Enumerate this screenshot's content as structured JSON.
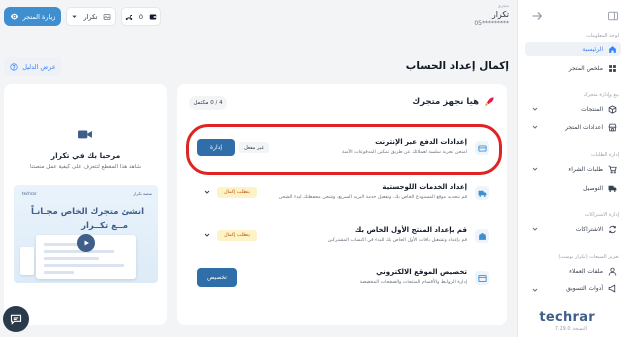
{
  "header": {
    "store_label": "متجري",
    "store_name": "تكرار",
    "phone": "05*********",
    "visit_store_label": "زيارة المتجر",
    "store_select_value": "تكرار",
    "stats_count": "0"
  },
  "sidebar": {
    "sections": [
      {
        "label": "لوحة المعلومات"
      },
      {
        "label": "بيع وإدارة متجرك"
      },
      {
        "label": "إدارة الطلبات"
      },
      {
        "label": "إدارة الاشتراكات"
      },
      {
        "label": "تعزيز المبيعات (تكرار بوست)"
      }
    ],
    "items": [
      {
        "label": "الرئيسية",
        "icon": "home-icon"
      },
      {
        "label": "ملخص المتجر",
        "icon": "grid-icon"
      },
      {
        "label": "المنتجات",
        "icon": "cube-icon"
      },
      {
        "label": "اعدادات المتجر",
        "icon": "store-icon"
      },
      {
        "label": "طلبات الشراء",
        "icon": "cart-icon"
      },
      {
        "label": "التوصيل",
        "icon": "truck-icon"
      },
      {
        "label": "الاشتراكات",
        "icon": "refresh-icon"
      },
      {
        "label": "ملفات العملاء",
        "icon": "user-icon"
      },
      {
        "label": "أدوات التسويق",
        "icon": "megaphone-icon"
      }
    ],
    "logo": "techrar",
    "version": "النسخة 7.29.0"
  },
  "page": {
    "title": "إكمال إعداد الحساب",
    "guide_label": "عرض الدليل"
  },
  "welcome": {
    "title": "مرحبا بك في تكرار",
    "subtitle": "شاهد هذا المقطع لتتعرف على كيفية عمل منصتنا",
    "thumb_brand": "techrar",
    "thumb_tag": "منصة تكرار",
    "thumb_line1": "انشئ متجرك الخاص مجـانـاً",
    "thumb_line2": "مــع تكــرار"
  },
  "setup": {
    "heading": "هيا نجهز متجرك",
    "progress": "4 / 0 مكتمل",
    "tasks": [
      {
        "title": "إعدادات الدفع عبر الإنترنت",
        "desc": "امنحن تجربة سلسة لعملائك عن طريق تمكين المدفوعات الآمنة",
        "badge": "غير مفعل",
        "action": "إدارة"
      },
      {
        "title": "إعداد الخدمات اللوجستية",
        "desc": "قم بتحديد موقع المستودع الخاص بك، وتفعيل خدمة البريد السريع، وشحن محفظتك لبدء الشحن",
        "badge": "يتطلب إكمال"
      },
      {
        "title": "قم بإعداد المنتج الأول الخاص بك",
        "desc": "قم بإعداد وتشغيل باقات الأول الخاص بك للبدء في اكتساب المشتركين",
        "badge": "يتطلب إكمال"
      },
      {
        "title": "تخصيص الموقع الالكتروني",
        "desc": "إدارة الروابط والأقسام المنتجات والصفحات المخصصة",
        "action": "تخصيص"
      }
    ]
  },
  "colors": {
    "primary": "#3f8fd0",
    "dark_blue": "#2f6ea8",
    "highlight": "#e02424"
  }
}
